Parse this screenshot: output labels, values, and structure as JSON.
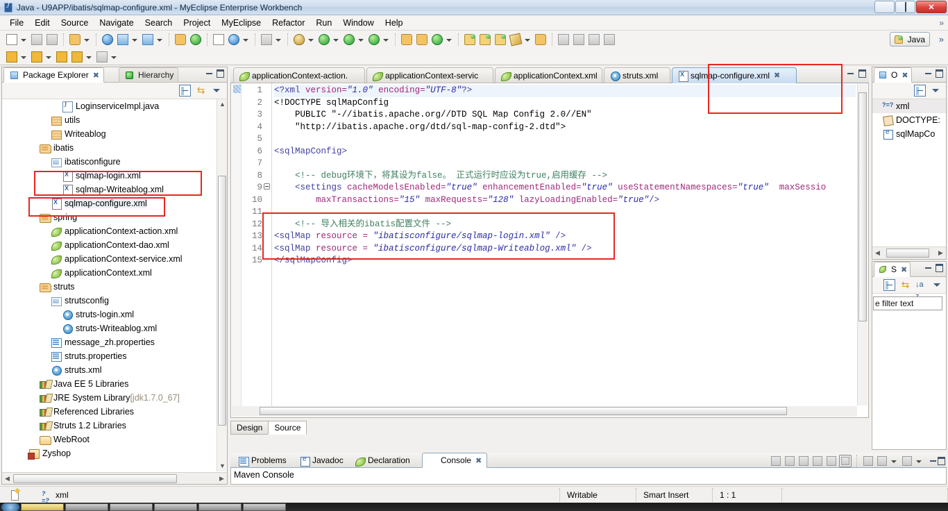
{
  "window": {
    "title": "Java - U9APP/ibatis/sqlmap-configure.xml - MyEclipse Enterprise Workbench",
    "icon": "myeclipse-icon",
    "minimize": "–",
    "maximize": "❐",
    "close": "✕"
  },
  "menubar": {
    "items": [
      "File",
      "Edit",
      "Source",
      "Navigate",
      "Search",
      "Project",
      "MyEclipse",
      "Refactor",
      "Run",
      "Window",
      "Help"
    ],
    "overflow": "»"
  },
  "toolbar": {
    "perspective_label": "Java",
    "overflow": "»",
    "row1_icons": [
      "new-wizard-icon",
      "new-dropdown-arrow",
      "save-icon",
      "print-icon",
      "separator",
      "export-deploy-icon",
      "deploy-dropdown-arrow",
      "separator",
      "web-browser-icon",
      "run-server-icon",
      "run-server-dropdown-arrow",
      "open-perspective-icon",
      "perspective-dropdown-arrow",
      "separator",
      "database-explorer-icon",
      "open-web-browser-icon",
      "separator",
      "report-icon",
      "web-service-icon",
      "web-service-dropdown-arrow",
      "separator",
      "snapshot-icon",
      "snapshot-dropdown-arrow",
      "separator",
      "debug-icon",
      "debug-dropdown-arrow",
      "run-icon",
      "run-dropdown-arrow",
      "run-config-icon",
      "run-config-dropdown-arrow",
      "profile-icon",
      "profile-dropdown-arrow",
      "separator",
      "external-tools-icon",
      "new-package-icon",
      "search-icon",
      "search-dropdown-arrow"
    ],
    "row2_icons": [
      "previous-annotation-icon",
      "prev-dropdown-arrow",
      "next-annotation-icon",
      "next-dropdown-arrow",
      "back-history-icon",
      "back-icon",
      "back-dropdown-arrow",
      "forward-icon",
      "forward-dropdown-arrow"
    ],
    "right_icons": [
      "open-type-icon",
      "open-type-2-icon",
      "open-type-3-icon",
      "edit-icon",
      "edit-dropdown-arrow",
      "open-resource-icon",
      "separator",
      "toggle-mark-icon",
      "toggle-block-icon",
      "expand-all-icon",
      "collapse-all-icon"
    ]
  },
  "package_explorer": {
    "tabs": [
      {
        "label": "Package Explorer",
        "icon": "package-explorer-icon",
        "active": true,
        "close": "✖"
      },
      {
        "label": "Hierarchy",
        "icon": "hierarchy-icon",
        "active": false
      }
    ],
    "view_tools": [
      "collapse-all-icon",
      "link-with-editor-icon",
      "view-menu-icon"
    ],
    "minimize": "–",
    "maximize": "❐",
    "tree": [
      {
        "label": "LoginserviceImpl.java",
        "icon": "java-file-icon",
        "indent": 5,
        "highlighted": false
      },
      {
        "label": "utils",
        "icon": "package-icon",
        "indent": 4,
        "highlighted": false
      },
      {
        "label": "Writeablog",
        "icon": "package-icon",
        "indent": 4,
        "highlighted": false
      },
      {
        "label": "ibatis",
        "icon": "source-folder-icon",
        "indent": 3,
        "highlighted": false
      },
      {
        "label": "ibatisconfigure",
        "icon": "package-fragment-icon",
        "indent": 4,
        "highlighted": false
      },
      {
        "label": "sqlmap-login.xml",
        "icon": "xml-file-icon",
        "indent": 5,
        "highlighted": true
      },
      {
        "label": "sqlmap-Writeablog.xml",
        "icon": "xml-file-icon",
        "indent": 5,
        "highlighted": true
      },
      {
        "label": "sqlmap-configure.xml",
        "icon": "xml-file-icon",
        "indent": 4,
        "highlighted": true,
        "selected": true
      },
      {
        "label": "spring",
        "icon": "source-folder-icon",
        "indent": 3,
        "highlighted": false
      },
      {
        "label": "applicationContext-action.xml",
        "icon": "spring-file-icon",
        "indent": 4,
        "highlighted": false
      },
      {
        "label": "applicationContext-dao.xml",
        "icon": "spring-file-icon",
        "indent": 4,
        "highlighted": false
      },
      {
        "label": "applicationContext-service.xml",
        "icon": "spring-file-icon",
        "indent": 4,
        "highlighted": false
      },
      {
        "label": "applicationContext.xml",
        "icon": "spring-file-icon",
        "indent": 4,
        "highlighted": false
      },
      {
        "label": "struts",
        "icon": "source-folder-icon",
        "indent": 3,
        "highlighted": false
      },
      {
        "label": "strutsconfig",
        "icon": "package-fragment-icon",
        "indent": 4,
        "highlighted": false
      },
      {
        "label": "struts-login.xml",
        "icon": "struts-file-icon",
        "indent": 5,
        "highlighted": false
      },
      {
        "label": "struts-Writeablog.xml",
        "icon": "struts-file-icon",
        "indent": 5,
        "highlighted": false
      },
      {
        "label": "message_zh.properties",
        "icon": "properties-file-icon",
        "indent": 4,
        "highlighted": false
      },
      {
        "label": "struts.properties",
        "icon": "properties-file-icon",
        "indent": 4,
        "highlighted": false
      },
      {
        "label": "struts.xml",
        "icon": "struts-file-icon",
        "indent": 4,
        "highlighted": false
      },
      {
        "label": "Java EE 5 Libraries",
        "icon": "library-icon",
        "indent": 3,
        "highlighted": false
      },
      {
        "label": "JRE System Library ",
        "sublabel": "[jdk1.7.0_67]",
        "icon": "library-icon",
        "indent": 3,
        "highlighted": false
      },
      {
        "label": "Referenced Libraries",
        "icon": "library-icon",
        "indent": 3,
        "highlighted": false
      },
      {
        "label": "Struts 1.2 Libraries",
        "icon": "library-icon",
        "indent": 3,
        "highlighted": false
      },
      {
        "label": "WebRoot",
        "icon": "folder-icon",
        "indent": 3,
        "highlighted": false
      },
      {
        "label": "Zyshop",
        "icon": "project-icon",
        "indent": 2,
        "highlighted": false
      }
    ]
  },
  "editor": {
    "tabs": [
      {
        "label": "applicationContext-action.",
        "icon": "spring-file-icon",
        "active": false
      },
      {
        "label": "applicationContext-servic",
        "icon": "spring-file-icon",
        "active": false
      },
      {
        "label": "applicationContext.xml",
        "icon": "spring-file-icon",
        "active": false
      },
      {
        "label": "struts.xml",
        "icon": "struts-file-icon",
        "active": false
      },
      {
        "label": "sqlmap-configure.xml",
        "icon": "xml-file-icon",
        "active": true,
        "close": "✖"
      }
    ],
    "minimize": "–",
    "maximize": "❐",
    "line_numbers": [
      "1",
      "2",
      "3",
      "4",
      "5",
      "6",
      "7",
      "8",
      "9",
      "10",
      "11",
      "12",
      "13",
      "14",
      "15"
    ],
    "fold_line": 9,
    "bottom_tabs": [
      {
        "label": "Design",
        "active": false
      },
      {
        "label": "Source",
        "active": true
      }
    ],
    "code_lines": [
      [
        {
          "t": "<?xml ",
          "c": "tag"
        },
        {
          "t": "version=",
          "c": "attr"
        },
        {
          "t": "\"1.0\"",
          "c": "val"
        },
        {
          "t": " ",
          "c": "txt"
        },
        {
          "t": "encoding=",
          "c": "attr"
        },
        {
          "t": "\"UTF-8\"",
          "c": "val"
        },
        {
          "t": "?>",
          "c": "tag"
        }
      ],
      [
        {
          "t": "<!DOCTYPE sqlMapConfig",
          "c": "dtd"
        }
      ],
      [
        {
          "t": "    PUBLIC \"-//ibatis.apache.org//DTD SQL Map Config 2.0//EN\"",
          "c": "dtd"
        }
      ],
      [
        {
          "t": "    \"http://ibatis.apache.org/dtd/sql-map-config-2.dtd\">",
          "c": "dtd"
        }
      ],
      [
        {
          "t": "",
          "c": "txt"
        }
      ],
      [
        {
          "t": "<sqlMapConfig>",
          "c": "tag"
        }
      ],
      [
        {
          "t": "",
          "c": "txt"
        }
      ],
      [
        {
          "t": "    <!-- debug环境下，将其设为false。 正式运行时应设为true,启用缓存 -->",
          "c": "cmt"
        }
      ],
      [
        {
          "t": "    <settings ",
          "c": "tag"
        },
        {
          "t": "cacheModelsEnabled=",
          "c": "attr"
        },
        {
          "t": "\"true\"",
          "c": "val"
        },
        {
          "t": " ",
          "c": "txt"
        },
        {
          "t": "enhancementEnabled=",
          "c": "attr"
        },
        {
          "t": "\"true\"",
          "c": "val"
        },
        {
          "t": " ",
          "c": "txt"
        },
        {
          "t": "useStatementNamespaces=",
          "c": "attr"
        },
        {
          "t": "\"true\"",
          "c": "val"
        },
        {
          "t": "  ",
          "c": "txt"
        },
        {
          "t": "maxSessio",
          "c": "attr"
        }
      ],
      [
        {
          "t": "        ",
          "c": "txt"
        },
        {
          "t": "maxTransactions=",
          "c": "attr"
        },
        {
          "t": "\"15\"",
          "c": "val"
        },
        {
          "t": " ",
          "c": "txt"
        },
        {
          "t": "maxRequests=",
          "c": "attr"
        },
        {
          "t": "\"128\"",
          "c": "val"
        },
        {
          "t": " ",
          "c": "txt"
        },
        {
          "t": "lazyLoadingEnabled=",
          "c": "attr"
        },
        {
          "t": "\"true\"",
          "c": "val"
        },
        {
          "t": "/>",
          "c": "tag"
        }
      ],
      [
        {
          "t": "",
          "c": "txt"
        }
      ],
      [
        {
          "t": "    <!-- 导入相关的ibatis配置文件 -->",
          "c": "cmt"
        }
      ],
      [
        {
          "t": "<sqlMap ",
          "c": "tag"
        },
        {
          "t": "resource = ",
          "c": "attr"
        },
        {
          "t": "\"ibatisconfigure/sqlmap-login.xml\"",
          "c": "val"
        },
        {
          "t": " />",
          "c": "tag"
        }
      ],
      [
        {
          "t": "<sqlMap ",
          "c": "tag"
        },
        {
          "t": "resource = ",
          "c": "attr"
        },
        {
          "t": "\"ibatisconfigure/sqlmap-Writeablog.xml\"",
          "c": "val"
        },
        {
          "t": " />",
          "c": "tag"
        }
      ],
      [
        {
          "t": "</sqlMapConfig>",
          "c": "tag"
        }
      ]
    ]
  },
  "outline": {
    "tab_label": "O",
    "tab_close": "✖",
    "icon": "outline-icon",
    "view_tools": [
      "collapse-all-icon",
      "view-menu-icon"
    ],
    "minimize": "–",
    "maximize": "❐",
    "items": [
      {
        "label": "xml",
        "icon": "processing-instruction-icon",
        "selected": true
      },
      {
        "label": "DOCTYPE:",
        "icon": "doctype-icon",
        "selected": false
      },
      {
        "label": "sqlMapCo",
        "icon": "element-icon",
        "selected": false
      }
    ]
  },
  "snippets": {
    "tab_label": "S",
    "tab_close": "✖",
    "icon": "snippets-icon",
    "view_tools": [
      "collapse-all-icon",
      "link-with-editor-icon",
      "sort-icon",
      "view-menu-icon"
    ],
    "minimize": "–",
    "maximize": "❐",
    "filter_text": "e filter text"
  },
  "console": {
    "tabs": [
      {
        "label": "Problems",
        "icon": "problems-icon",
        "active": false
      },
      {
        "label": "Javadoc",
        "icon": "javadoc-icon",
        "active": false
      },
      {
        "label": "Declaration",
        "icon": "declaration-icon",
        "active": false
      },
      {
        "label": "Console",
        "icon": "console-icon",
        "active": true,
        "close": "✖"
      }
    ],
    "tools": [
      "terminate-icon",
      "remove-launch-icon",
      "remove-all-icon",
      "scroll-lock-icon",
      "clear-console-icon",
      "pin-console-icon",
      "separator",
      "new-console-view-icon",
      "display-console-icon",
      "display-dropdown-arrow",
      "open-console-icon",
      "open-dropdown-arrow"
    ],
    "minimize": "–",
    "maximize": "❐",
    "content": "Maven Console"
  },
  "statusbar": {
    "icon": "editor-state-icon",
    "content_type": "xml",
    "content_type_icon": "processing-instruction-icon",
    "writable": "Writable",
    "insert_mode": "Smart Insert",
    "position": "1 : 1"
  },
  "annotations": {
    "boxes": [
      "tree-sqlmap-login-box",
      "tree-sqlmap-configure-box",
      "editor-tab-box",
      "code-import-box"
    ],
    "color": "#e8261e"
  }
}
